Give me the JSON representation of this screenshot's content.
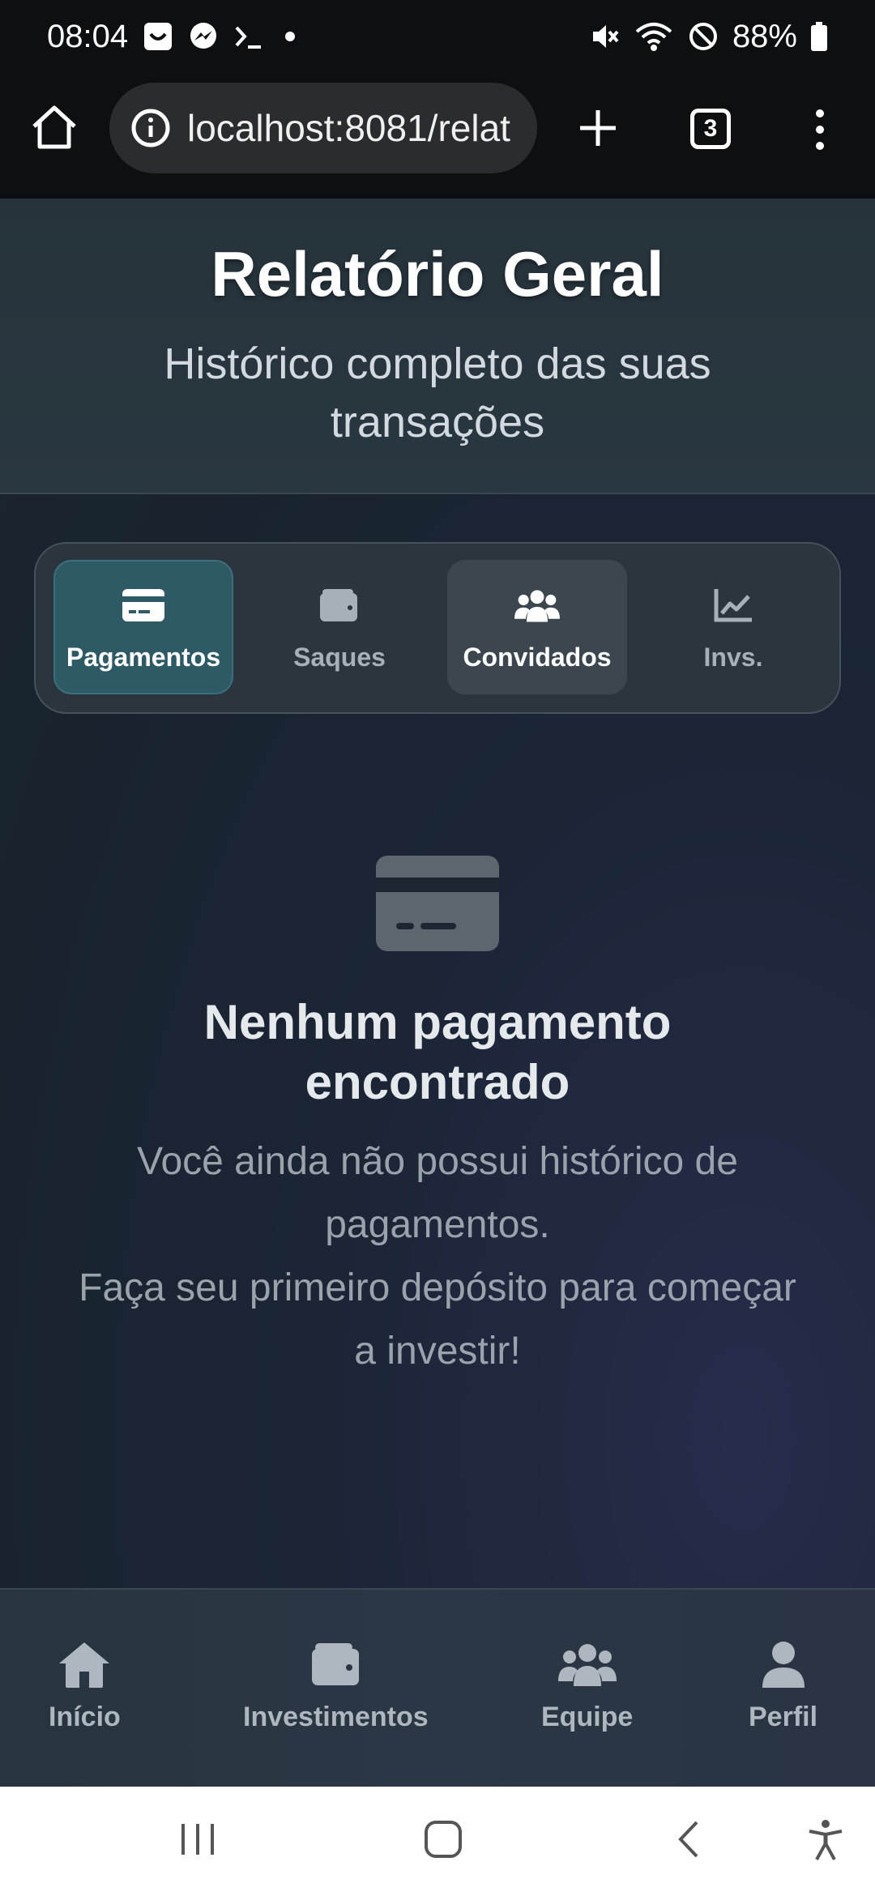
{
  "status_bar": {
    "time": "08:04",
    "battery": "88%",
    "left_icons": [
      "smile-app-icon",
      "messenger-icon",
      "terminal-icon",
      "dot-icon"
    ],
    "right_icons": [
      "mute-icon",
      "wifi-icon",
      "dnd-icon",
      "battery-icon"
    ]
  },
  "browser": {
    "url": "localhost:8081/relat",
    "tab_count": "3"
  },
  "header": {
    "title": "Relatório Geral",
    "subtitle": "Histórico completo das suas transações"
  },
  "tabs": [
    {
      "label": "Pagamentos",
      "icon": "credit-card-icon",
      "state": "active"
    },
    {
      "label": "Saques",
      "icon": "wallet-icon",
      "state": "normal"
    },
    {
      "label": "Convidados",
      "icon": "users-icon",
      "state": "highlighted"
    },
    {
      "label": "Invs.",
      "icon": "chart-line-icon",
      "state": "normal"
    }
  ],
  "empty_state": {
    "icon": "credit-card-icon",
    "title": "Nenhum pagamento encontrado",
    "line1": "Você ainda não possui histórico de pagamentos.",
    "line2": "Faça seu primeiro depósito para começar a investir!"
  },
  "bottom_nav": [
    {
      "label": "Início",
      "icon": "home-icon"
    },
    {
      "label": "Investimentos",
      "icon": "wallet-icon"
    },
    {
      "label": "Equipe",
      "icon": "users-icon"
    },
    {
      "label": "Perfil",
      "icon": "user-icon"
    }
  ],
  "colors": {
    "active_tab": "#2e5a66",
    "page_bg": "#1b2536",
    "header_bg": "#26333b",
    "accent_line": "#4a8ef0"
  }
}
